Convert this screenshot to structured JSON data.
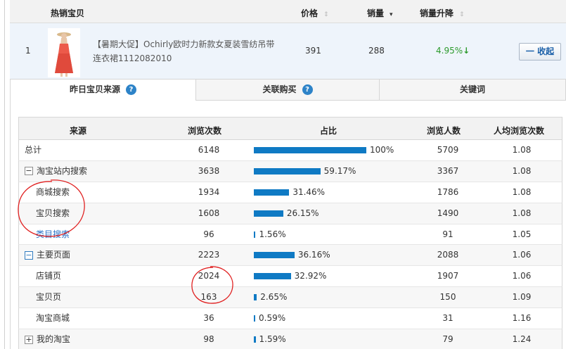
{
  "header": {
    "title": "热销宝贝",
    "price": "价格",
    "sales": "销量",
    "sales_change": "销量升降",
    "sort_icon": "sort-arrows-icon"
  },
  "product": {
    "rank": "1",
    "title_line1": "【暑期大促】Ochirly欧时力新款女夏装雪纺吊带",
    "title_line2": "连衣裙1112082010",
    "price": "391",
    "sales": "288",
    "change": "4.95%",
    "change_icon": "down-arrow-icon",
    "collapse_label": "一 收起"
  },
  "tabs": [
    {
      "label": "昨日宝贝来源",
      "active": true
    },
    {
      "label": "关联购买",
      "active": false
    },
    {
      "label": "关键词",
      "active": false
    }
  ],
  "table": {
    "headers": [
      "来源",
      "浏览次数",
      "占比",
      "浏览人数",
      "人均浏览次数"
    ],
    "rows": [
      {
        "source": "总计",
        "expander": "",
        "views": "6148",
        "share": 100,
        "share_label": "100%",
        "visitors": "5709",
        "avg": "1.08"
      },
      {
        "source": "淘宝站内搜索",
        "expander": "−",
        "views": "3638",
        "share": 59.17,
        "share_label": "59.17%",
        "visitors": "3367",
        "avg": "1.08"
      },
      {
        "source": "商城搜索",
        "expander": "",
        "views": "1934",
        "share": 31.46,
        "share_label": "31.46%",
        "visitors": "1786",
        "avg": "1.08"
      },
      {
        "source": "宝贝搜索",
        "expander": "",
        "views": "1608",
        "share": 26.15,
        "share_label": "26.15%",
        "visitors": "1490",
        "avg": "1.08"
      },
      {
        "source": "类目搜索",
        "expander": "",
        "views": "96",
        "share": 1.56,
        "share_label": "1.56%",
        "visitors": "91",
        "avg": "1.05"
      },
      {
        "source": "主要页面",
        "expander": "−",
        "views": "2223",
        "share": 36.16,
        "share_label": "36.16%",
        "visitors": "2088",
        "avg": "1.06"
      },
      {
        "source": "店铺页",
        "expander": "",
        "views": "2024",
        "share": 32.92,
        "share_label": "32.92%",
        "visitors": "1907",
        "avg": "1.06"
      },
      {
        "source": "宝贝页",
        "expander": "",
        "views": "163",
        "share": 2.65,
        "share_label": "2.65%",
        "visitors": "150",
        "avg": "1.09"
      },
      {
        "source": "淘宝商城",
        "expander": "",
        "views": "36",
        "share": 0.59,
        "share_label": "0.59%",
        "visitors": "31",
        "avg": "1.16"
      },
      {
        "source": "我的淘宝",
        "expander": "+",
        "views": "98",
        "share": 1.59,
        "share_label": "1.59%",
        "visitors": "79",
        "avg": "1.24"
      }
    ]
  },
  "colors": {
    "bar": "#0f7ac4",
    "link": "#2a72c8",
    "positive": "#2c9a2c",
    "annotation": "#e02020"
  }
}
